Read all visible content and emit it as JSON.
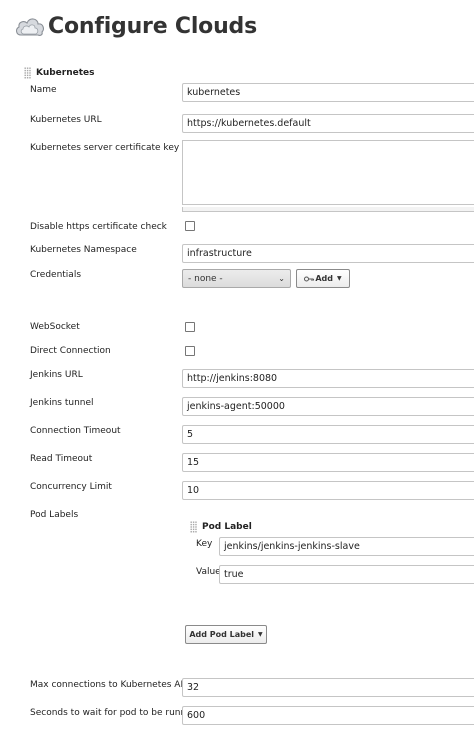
{
  "page": {
    "title": "Configure Clouds"
  },
  "section": {
    "title": "Kubernetes"
  },
  "fields": {
    "name": {
      "label": "Name",
      "value": "kubernetes"
    },
    "url": {
      "label": "Kubernetes URL",
      "value": "https://kubernetes.default"
    },
    "cert": {
      "label": "Kubernetes server certificate key",
      "value": ""
    },
    "disable_https": {
      "label": "Disable https certificate check",
      "checked": false
    },
    "namespace": {
      "label": "Kubernetes Namespace",
      "value": "infrastructure"
    },
    "credentials": {
      "label": "Credentials",
      "selected": "- none -",
      "add_label": "Add"
    },
    "websocket": {
      "label": "WebSocket",
      "checked": false
    },
    "direct": {
      "label": "Direct Connection",
      "checked": false
    },
    "jenkins_url": {
      "label": "Jenkins URL",
      "value": "http://jenkins:8080"
    },
    "jenkins_tunnel": {
      "label": "Jenkins tunnel",
      "value": "jenkins-agent:50000"
    },
    "conn_timeout": {
      "label": "Connection Timeout",
      "value": "5"
    },
    "read_timeout": {
      "label": "Read Timeout",
      "value": "15"
    },
    "concurrency": {
      "label": "Concurrency Limit",
      "value": "10"
    },
    "pod_labels": {
      "label": "Pod Labels",
      "item_title": "Pod Label",
      "key_label": "Key",
      "key_value": "jenkins/jenkins-jenkins-slave",
      "value_label": "Value",
      "value_value": "true",
      "add_button": "Add Pod Label"
    },
    "max_conn": {
      "label": "Max connections to Kubernetes API",
      "value": "32"
    },
    "pod_wait": {
      "label": "Seconds to wait for pod to be running",
      "value": "600"
    }
  },
  "colors": {
    "border": "#c5c5c5",
    "text": "#222222",
    "title": "#333333"
  },
  "icons": {
    "title": "cloud-icon",
    "drag": "drag-handle-icon",
    "credentials": "key-icon"
  }
}
